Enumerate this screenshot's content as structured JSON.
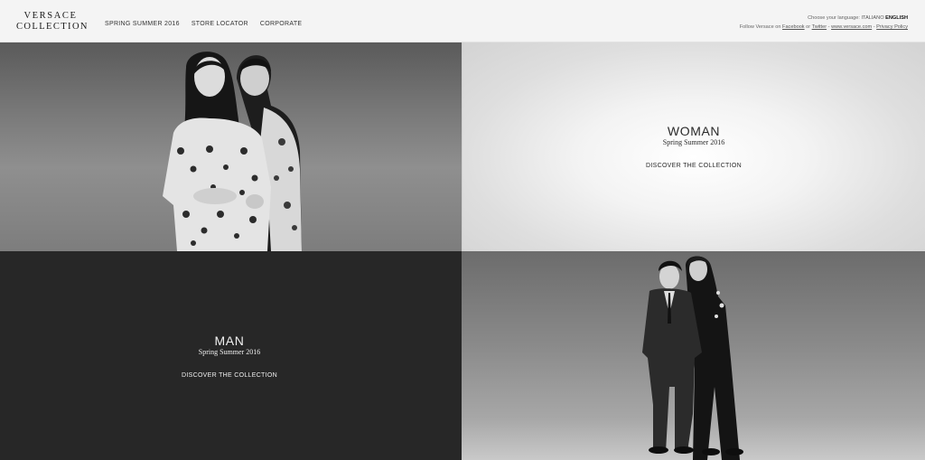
{
  "header": {
    "logo": {
      "line1": "VERSACE",
      "line2": "COLLECTION"
    },
    "nav": [
      {
        "label": "SPRING SUMMER 2016"
      },
      {
        "label": "STORE LOCATOR"
      },
      {
        "label": "CORPORATE"
      }
    ],
    "language": {
      "prompt": "Choose your language:",
      "options": [
        "ITALIANO",
        "ENGLISH"
      ],
      "selected": "ENGLISH"
    },
    "follow": {
      "prefix": "Follow Versace on",
      "facebook": "Facebook",
      "or": "or",
      "twitter": "Twitter",
      "sep1": "-",
      "site": "www.versace.com",
      "sep2": "-",
      "privacy": "Privacy Policy"
    }
  },
  "woman": {
    "title": "WOMAN",
    "subtitle": "Spring Summer 2016",
    "cta": "DISCOVER THE COLLECTION"
  },
  "man": {
    "title": "MAN",
    "subtitle": "Spring Summer 2016",
    "cta": "DISCOVER THE COLLECTION"
  },
  "colors": {
    "header_bg": "#f4f4f4",
    "dark_panel": "#272727",
    "light_panel": "#f3f3f3"
  }
}
